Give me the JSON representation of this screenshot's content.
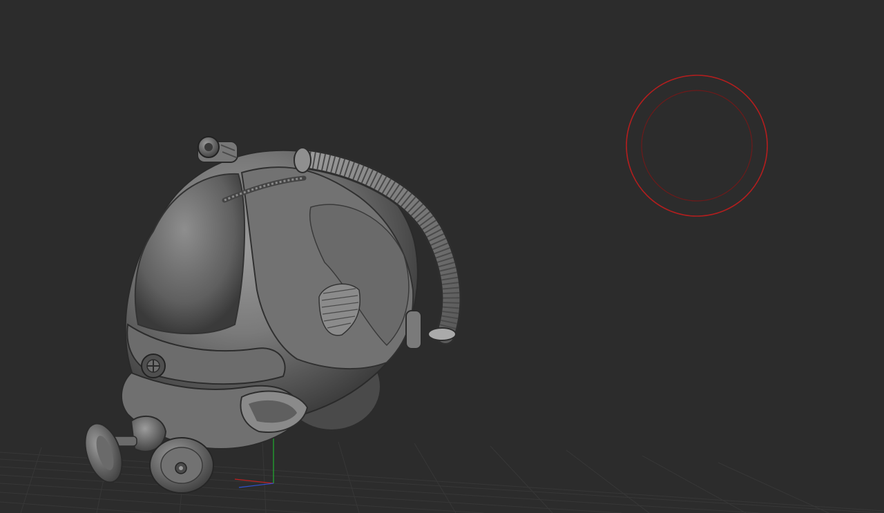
{
  "viewport": {
    "background_color": "#2c2c2c",
    "grid_color": "#3a3a3a",
    "model": {
      "subject": "helmet-mesh",
      "base_color": "#7a7a7a",
      "shadow_color": "#2e2e2e",
      "highlight_color": "#a8a8a8"
    },
    "brush_cursor": {
      "outer_color": "#b21e1e",
      "inner_color": "#6e1a1a"
    },
    "axis_gizmo": {
      "x_axis_color": "#c02020",
      "y_axis_color": "#20b030",
      "z_axis_color": "#3050d0"
    }
  }
}
